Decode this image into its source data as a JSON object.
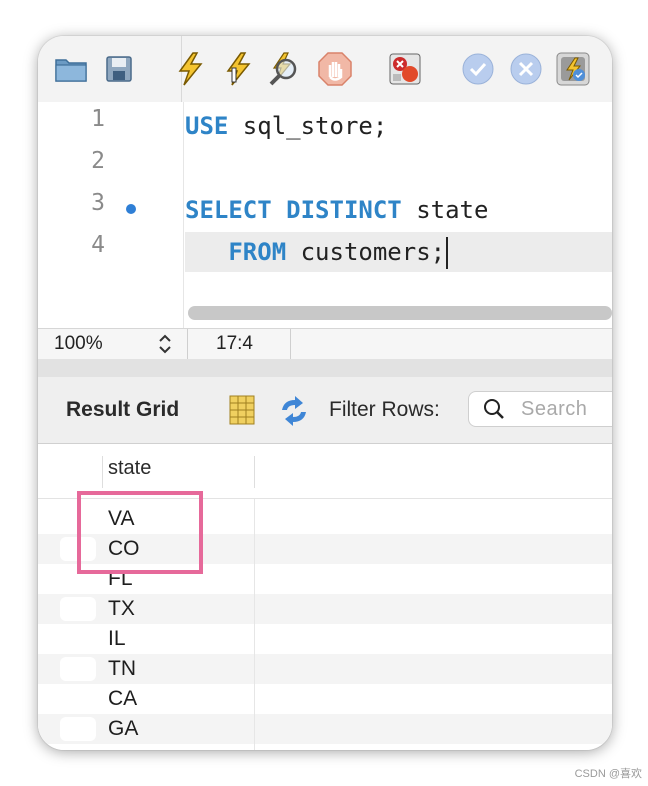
{
  "toolbar": {
    "icons": [
      "open-folder-icon",
      "save-disk-icon",
      "execute-lightning-icon",
      "execute-current-lightning-icon",
      "explain-magnifier-icon",
      "stop-hand-icon",
      "toggle-error-stop-icon",
      "commit-check-icon",
      "rollback-x-icon",
      "autocommit-icon"
    ]
  },
  "editor": {
    "line_numbers": [
      "1",
      "2",
      "3",
      "4"
    ],
    "line1": {
      "kw": "USE",
      "rest": " sql_store;"
    },
    "line3": {
      "kw": "SELECT DISTINCT",
      "rest": " state"
    },
    "line4": {
      "indent": "   ",
      "kw": "FROM",
      "rest": " customers;"
    }
  },
  "statusbar": {
    "zoom": "100%",
    "cursor": "17:4"
  },
  "results": {
    "title": "Result Grid",
    "filter_label": "Filter Rows:",
    "search_placeholder": "Search",
    "column_header": "state",
    "rows": [
      "VA",
      "CO",
      "FL",
      "TX",
      "IL",
      "TN",
      "CA",
      "GA"
    ]
  },
  "watermark": "CSDN @喜欢",
  "colors": {
    "keyword": "#2e84c7",
    "highlight_box": "#e6699a",
    "exec_dot": "#2f7fd6"
  }
}
